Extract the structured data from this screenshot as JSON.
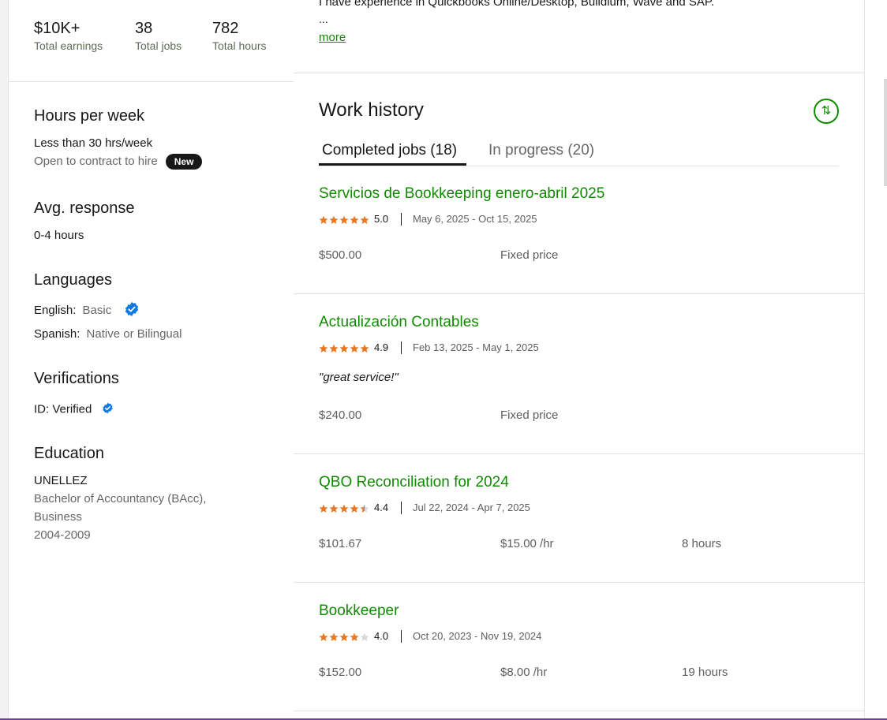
{
  "stats": [
    {
      "value": "$10K+",
      "label": "Total earnings"
    },
    {
      "value": "38",
      "label": "Total jobs"
    },
    {
      "value": "782",
      "label": "Total hours"
    }
  ],
  "hours_per_week": {
    "title": "Hours per week",
    "value": "Less than 30 hrs/week",
    "contract": "Open to contract to hire",
    "badge": "New"
  },
  "response": {
    "title": "Avg. response",
    "value": "0-4 hours"
  },
  "languages": {
    "title": "Languages",
    "items": [
      {
        "name": "English:",
        "level": "Basic"
      },
      {
        "name": "Spanish:",
        "level": "Native or Bilingual"
      }
    ]
  },
  "verifications": {
    "title": "Verifications",
    "id_label": "ID: Verified"
  },
  "education": {
    "title": "Education",
    "school": "UNELLEZ",
    "degree_line1": "Bachelor of Accountancy (BAcc),",
    "degree_line2": "Business",
    "years": "2004-2009"
  },
  "overview": {
    "text": "I have experience in Quickbooks Online/Desktop, Buildium, Wave and SAP.",
    "ellipsis": "...",
    "more": "more"
  },
  "work_history": {
    "title": "Work history",
    "tabs": [
      {
        "label": "Completed jobs (18)"
      },
      {
        "label": "In progress (20)"
      }
    ],
    "jobs": [
      {
        "title": "Servicios de Bookkeeping enero-abril 2025",
        "rating": 5.0,
        "rating_text": "5.0",
        "dates": "May 6, 2025 - Oct 15, 2025",
        "quote": "",
        "amount": "$500.00",
        "type": "Fixed price",
        "hours": ""
      },
      {
        "title": "Actualización Contables",
        "rating": 4.9,
        "rating_text": "4.9",
        "dates": "Feb 13, 2025 - May 1, 2025",
        "quote": "\"great service!\"",
        "amount": "$240.00",
        "type": "Fixed price",
        "hours": ""
      },
      {
        "title": "QBO Reconciliation for 2024",
        "rating": 4.4,
        "rating_text": "4.4",
        "dates": "Jul 22, 2024 - Apr 7, 2025",
        "quote": "",
        "amount": "$101.67",
        "type": "$15.00 /hr",
        "hours": "8 hours"
      },
      {
        "title": "Bookkeeper",
        "rating": 4.0,
        "rating_text": "4.0",
        "dates": "Oct 20, 2023 - Nov 19, 2024",
        "quote": "",
        "amount": "$152.00",
        "type": "$8.00 /hr",
        "hours": "19 hours"
      }
    ]
  },
  "colors": {
    "accent": "#108a00",
    "star": "#e87722",
    "verified": "#0f7ae5"
  }
}
